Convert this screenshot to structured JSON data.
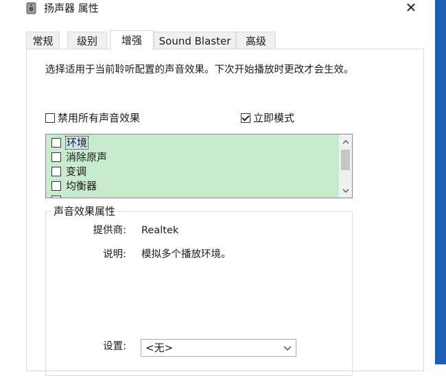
{
  "window": {
    "title": "扬声器 属性",
    "close_glyph": "✕"
  },
  "tabs": [
    {
      "label": "常规",
      "active": false
    },
    {
      "label": "级别",
      "active": false
    },
    {
      "label": "增强",
      "active": true
    },
    {
      "label": "Sound Blaster",
      "active": false
    },
    {
      "label": "高级",
      "active": false
    }
  ],
  "description": "选择适用于当前聆听配置的声音效果。下次开始播放时更改才会生效。",
  "options": {
    "disable_all": {
      "label": "禁用所有声音效果",
      "checked": false
    },
    "immediate_mode": {
      "label": "立即模式",
      "checked": true
    }
  },
  "effects": [
    {
      "label": "环境",
      "checked": false,
      "selected": true
    },
    {
      "label": "消除原声",
      "checked": false,
      "selected": false
    },
    {
      "label": "变调",
      "checked": false,
      "selected": false
    },
    {
      "label": "均衡器",
      "checked": false,
      "selected": false
    }
  ],
  "properties": {
    "group_title": "声音效果属性",
    "provider_label": "提供商:",
    "provider_value": "Realtek",
    "description_label": "说明:",
    "description_value": "模拟多个播放环境。",
    "settings_label": "设置:",
    "settings_value": "<无>"
  },
  "colors": {
    "list_background": "#c9ebcd",
    "desktop_accent": "#1f5fb3"
  },
  "icons": {
    "app": "speaker-icon",
    "close": "close-icon",
    "scroll_up": "scroll-up-icon",
    "scroll_down": "scroll-down-icon",
    "dropdown": "chevron-down-icon"
  }
}
